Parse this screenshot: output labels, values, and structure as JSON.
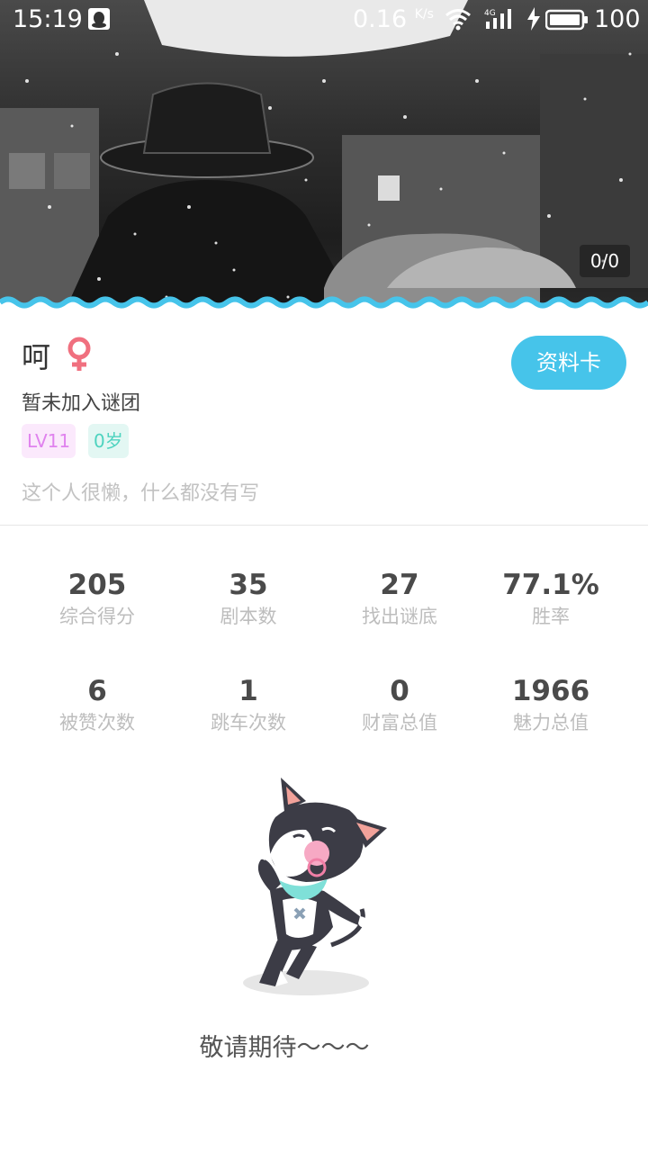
{
  "status_bar": {
    "time": "15:19",
    "network_speed": "0.16",
    "network_speed_unit": "K/s",
    "network_type": "4G",
    "battery_level": "100"
  },
  "banner": {
    "photo_counter": "0/0",
    "wave_color": "#46c4ea"
  },
  "profile": {
    "name": "呵",
    "gender_icon": "female-icon",
    "gender_color": "#f0707f",
    "group": "暂未加入谜团",
    "level_badge": "LV11",
    "age_badge": "0岁",
    "bio": "这个人很懒，什么都没有写",
    "card_button_label": "资料卡",
    "accent_color": "#46c4ea"
  },
  "stats": [
    {
      "value": "205",
      "label": "综合得分"
    },
    {
      "value": "35",
      "label": "剧本数"
    },
    {
      "value": "27",
      "label": "找出谜底"
    },
    {
      "value": "77.1%",
      "label": "胜率"
    },
    {
      "value": "6",
      "label": "被赞次数"
    },
    {
      "value": "1",
      "label": "跳车次数"
    },
    {
      "value": "0",
      "label": "财富总值"
    },
    {
      "value": "1966",
      "label": "魅力总值"
    }
  ],
  "empty_state": {
    "illustration": "cat-mascot-with-pacifier",
    "message": "敬请期待〜〜〜"
  }
}
